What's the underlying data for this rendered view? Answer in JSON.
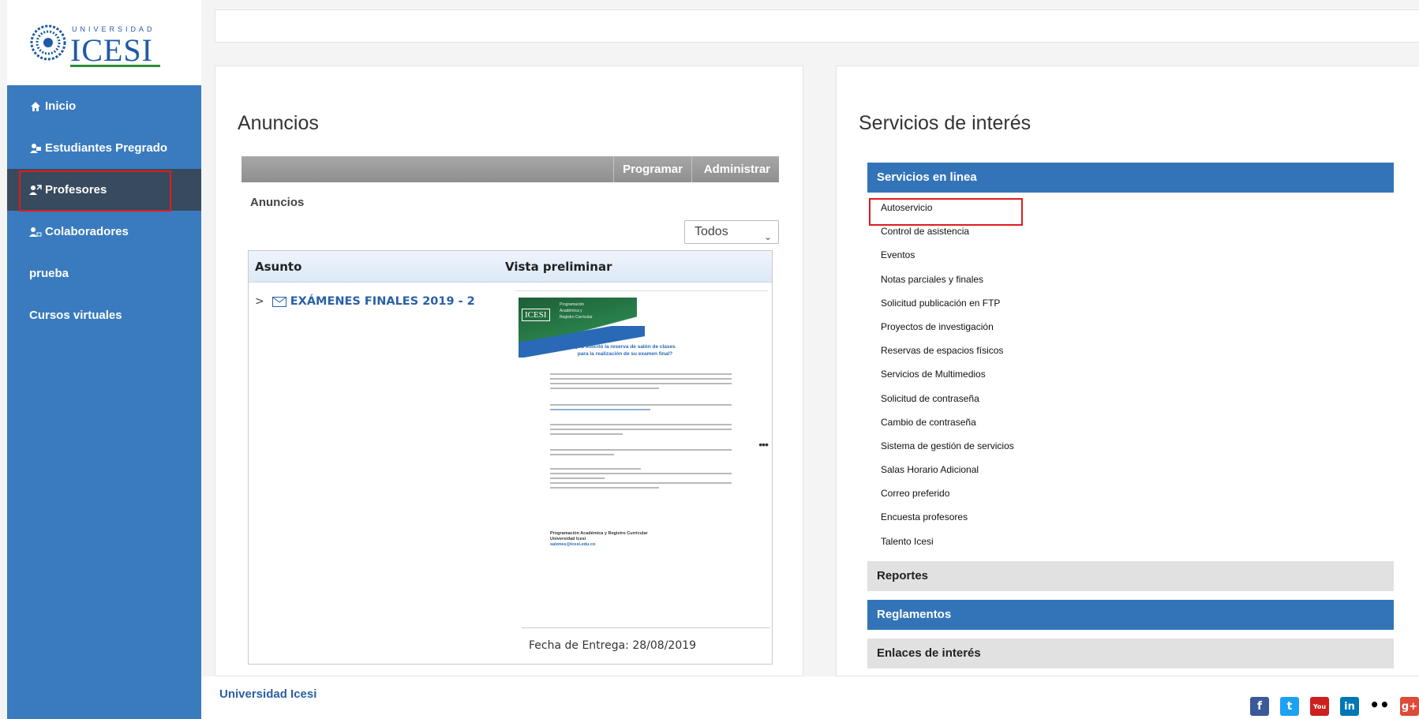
{
  "logo": {
    "small_text": "UNIVERSIDAD",
    "main_text": "ICESI"
  },
  "sidebar": {
    "items": [
      {
        "label": "Inicio",
        "icon": "home-icon"
      },
      {
        "label": "Estudiantes Pregrado",
        "icon": "students-icon"
      },
      {
        "label": "Profesores",
        "icon": "teacher-icon",
        "active": true
      },
      {
        "label": "Colaboradores",
        "icon": "collaborators-icon"
      },
      {
        "label": "prueba",
        "icon": ""
      },
      {
        "label": "Cursos virtuales",
        "icon": ""
      }
    ]
  },
  "anuncios": {
    "title": "Anuncios",
    "toolbar": {
      "programar": "Programar",
      "administrar": "Administrar"
    },
    "subtitle": "Anuncios",
    "filter": {
      "selected": "Todos"
    },
    "table": {
      "headers": [
        "Asunto",
        "Vista preliminar"
      ],
      "rows": [
        {
          "subject": "EXÁMENES FINALES 2019 - 2"
        }
      ]
    },
    "preview": {
      "flyer_logo": "ICESI",
      "flyer_header": [
        "Programación",
        "Académica y",
        "Registro Curricular"
      ],
      "flyer_question": [
        "¿Ya solicitó la reserva de salón de clases",
        "para la realización de su examen final?"
      ],
      "flyer_signature": [
        "Programación Académica y Registro Curricular",
        "Universidad Icesi",
        "salones@icesi.edu.co"
      ],
      "fecha": "Fecha de Entrega: 28/08/2019"
    }
  },
  "servicios": {
    "title": "Servicios de interés",
    "sections": {
      "en_linea": "Servicios en linea",
      "reportes": "Reportes",
      "reglamentos": "Reglamentos",
      "enlaces": "Enlaces de interés"
    },
    "links": [
      "Autoservicio",
      "Control de asistencia",
      "Eventos",
      "Notas parciales y finales",
      "Solicitud publicación en FTP",
      "Proyectos de investigación",
      "Reservas de espacios físicos",
      "Servicios de Multimedios",
      "Solicitud de contraseña",
      "Cambio de contraseña",
      "Sistema de gestión de servicios",
      "Salas Horario Adicional",
      "Correo preferido",
      "Encuesta profesores",
      "Talento Icesi"
    ]
  },
  "footer": {
    "link": "Universidad Icesi"
  },
  "social": [
    {
      "name": "facebook-icon",
      "glyph": "f"
    },
    {
      "name": "twitter-icon",
      "glyph": "t"
    },
    {
      "name": "youtube-icon",
      "glyph": "You"
    },
    {
      "name": "linkedin-icon",
      "glyph": "in"
    },
    {
      "name": "flickr-icon",
      "glyph": "••"
    },
    {
      "name": "googleplus-icon",
      "glyph": "g+"
    }
  ]
}
